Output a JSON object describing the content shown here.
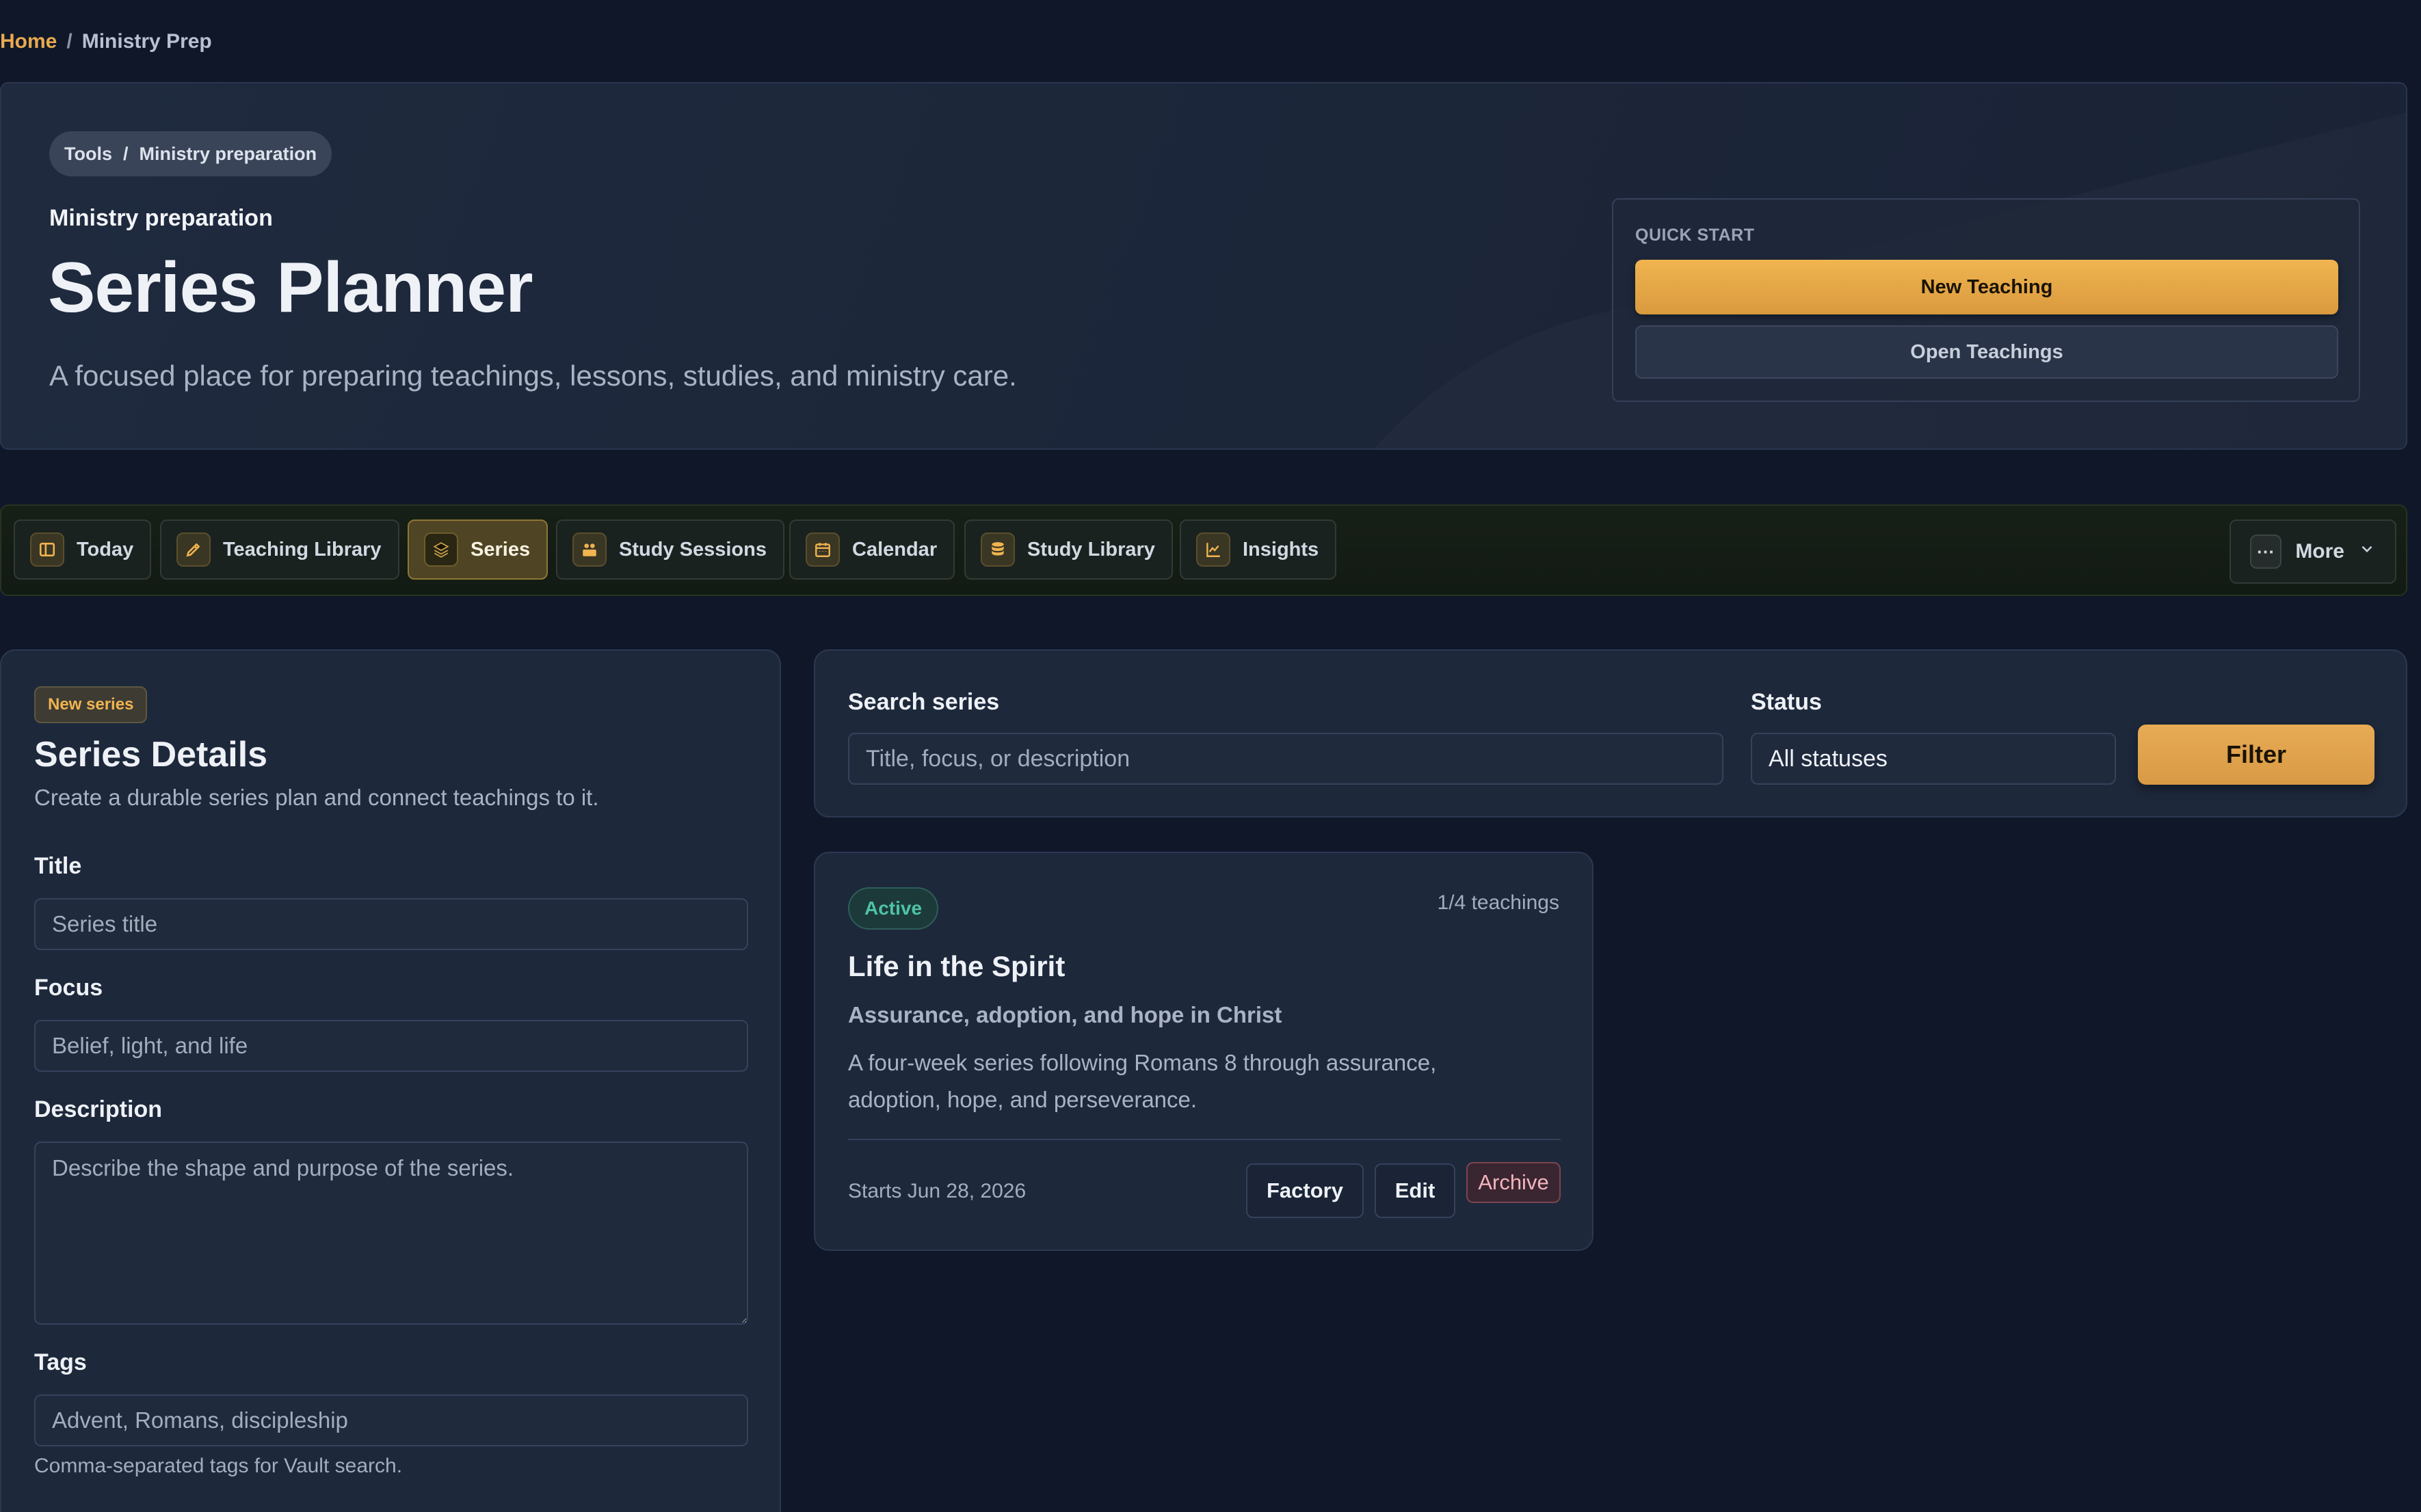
{
  "breadcrumb": {
    "home": "Home",
    "separator": "/",
    "current": "Ministry Prep"
  },
  "hero": {
    "pill": {
      "first": "Tools",
      "separator": "/",
      "second": "Ministry preparation"
    },
    "eyebrow": "Ministry preparation",
    "title": "Series Planner",
    "subtitle": "A focused place for preparing teachings, lessons, studies, and ministry care.",
    "quick_start": {
      "label": "QUICK START",
      "primary": "New Teaching",
      "secondary": "Open Teachings"
    }
  },
  "nav": {
    "tabs": [
      {
        "label": "Today",
        "icon": "layout-icon"
      },
      {
        "label": "Teaching Library",
        "icon": "pen-icon"
      },
      {
        "label": "Series",
        "icon": "layers-icon",
        "active": true
      },
      {
        "label": "Study Sessions",
        "icon": "book-people-icon"
      },
      {
        "label": "Calendar",
        "icon": "calendar-icon"
      },
      {
        "label": "Study Library",
        "icon": "database-icon"
      },
      {
        "label": "Insights",
        "icon": "chart-icon"
      }
    ],
    "more": {
      "label": "More",
      "icon_text": "···"
    }
  },
  "form": {
    "badge": "New series",
    "title": "Series Details",
    "subtitle": "Create a durable series plan and connect teachings to it.",
    "title_label": "Title",
    "title_placeholder": "Series title",
    "focus_label": "Focus",
    "focus_placeholder": "Belief, light, and life",
    "description_label": "Description",
    "description_placeholder": "Describe the shape and purpose of the series.",
    "tags_label": "Tags",
    "tags_placeholder": "Advent, Romans, discipleship",
    "tags_help": "Comma-separated tags for Vault search."
  },
  "search": {
    "search_label": "Search series",
    "search_placeholder": "Title, focus, or description",
    "status_label": "Status",
    "status_value": "All statuses",
    "filter_button": "Filter"
  },
  "series_card": {
    "status": "Active",
    "count": "1/4 teachings",
    "title": "Life in the Spirit",
    "focus": "Assurance, adoption, and hope in Christ",
    "description": "A four-week series following Romans 8 through assurance, adoption, hope, and perseverance.",
    "start": "Starts Jun 28, 2026",
    "factory_button": "Factory",
    "edit_button": "Edit",
    "archive_button": "Archive"
  },
  "colors": {
    "background": "#0f1729",
    "accent": "#e9a94f",
    "active_status": "#4fc3a6",
    "archive": "#f4b4be"
  }
}
